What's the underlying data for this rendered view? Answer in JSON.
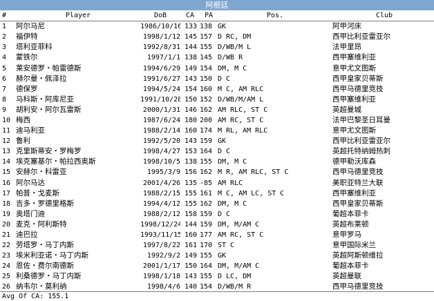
{
  "window": {
    "title": "阿根廷"
  },
  "columns": {
    "idx": "#",
    "player": "Player",
    "dob": "DoB",
    "ca": "CA",
    "pa": "PA",
    "pos": "Pos.",
    "club": "Club"
  },
  "rows": [
    {
      "idx": "1",
      "player": "阿尔马尼",
      "dob": "1986/10/16",
      "ca": "133",
      "pa": "138",
      "pos": "GK",
      "club": "阿甲河床"
    },
    {
      "idx": "2",
      "player": "福伊特",
      "dob": "1998/1/12",
      "ca": "145",
      "pa": "157",
      "pos": "D RC, DM",
      "club": "西甲比利亚雷亚尔"
    },
    {
      "idx": "3",
      "player": "塔利亚菲科",
      "dob": "1992/8/31",
      "ca": "144",
      "pa": "155",
      "pos": "D/WB/M L",
      "club": "法甲里昂"
    },
    {
      "idx": "4",
      "player": "蒙铁尔",
      "dob": "1997/1/1",
      "ca": "138",
      "pa": "145",
      "pos": "D/WB R",
      "club": "西甲塞维利亚"
    },
    {
      "idx": "5",
      "player": "莱安德罗・帕雷德斯",
      "dob": "1994/6/29",
      "ca": "149",
      "pa": "154",
      "pos": "DM, M C",
      "club": "意甲尤文图斯"
    },
    {
      "idx": "6",
      "player": "赫尔曼・佩泽拉",
      "dob": "1991/6/27",
      "ca": "143",
      "pa": "150",
      "pos": "D C",
      "club": "西甲皇家贝蒂斯"
    },
    {
      "idx": "7",
      "player": "德保罗",
      "dob": "1994/5/24",
      "ca": "154",
      "pa": "160",
      "pos": "M C, AM RLC",
      "club": "西甲马德里竞技"
    },
    {
      "idx": "8",
      "player": "马科斯・阿库尼亚",
      "dob": "1991/10/28",
      "ca": "150",
      "pa": "152",
      "pos": "D/WB/M/AM L",
      "club": "西甲塞维利亚"
    },
    {
      "idx": "9",
      "player": "胡利安・阿尔瓦雷斯",
      "dob": "2000/1/31",
      "ca": "146",
      "pa": "162",
      "pos": "AM RLC, ST C",
      "club": "英超曼城"
    },
    {
      "idx": "10",
      "player": "梅西",
      "dob": "1987/6/24",
      "ca": "180",
      "pa": "200",
      "pos": "AM RC, ST C",
      "club": "法甲巴黎圣日耳曼"
    },
    {
      "idx": "11",
      "player": "迪马利亚",
      "dob": "1988/2/14",
      "ca": "160",
      "pa": "174",
      "pos": "M RL, AM RLC",
      "club": "意甲尤文图斯"
    },
    {
      "idx": "12",
      "player": "鲁利",
      "dob": "1992/5/20",
      "ca": "143",
      "pa": "159",
      "pos": "GK",
      "club": "西甲比利亚雷亚尔"
    },
    {
      "idx": "13",
      "player": "克里斯蒂安・罗梅罗",
      "dob": "1998/4/27",
      "ca": "153",
      "pa": "164",
      "pos": "D C",
      "club": "英超托特纳姆热刺"
    },
    {
      "idx": "14",
      "player": "埃克塞基尔・帕拉西奥斯",
      "dob": "1998/10/5",
      "ca": "138",
      "pa": "155",
      "pos": "DM, M C",
      "club": "德甲勒沃库森"
    },
    {
      "idx": "15",
      "player": "安赫尔・科雷亚",
      "dob": "1995/3/9",
      "ca": "156",
      "pa": "162",
      "pos": "M R, AM RLC, ST C",
      "club": "西甲马德里竞技"
    },
    {
      "idx": "16",
      "player": "阿尔马达",
      "dob": "2001/4/26",
      "ca": "135",
      "pa": "-85",
      "pos": "AM RLC",
      "club": "美职亚特兰大联"
    },
    {
      "idx": "17",
      "player": "帕普・戈麦斯",
      "dob": "1988/2/15",
      "ca": "155",
      "pa": "161",
      "pos": "M C, AM LC, ST C",
      "club": "西甲塞维利亚"
    },
    {
      "idx": "18",
      "player": "吉多・罗德里格斯",
      "dob": "1994/4/12",
      "ca": "155",
      "pa": "162",
      "pos": "DM, M C",
      "club": "西甲皇家贝蒂斯"
    },
    {
      "idx": "19",
      "player": "奥塔门迪",
      "dob": "1988/2/12",
      "ca": "158",
      "pa": "159",
      "pos": "D C",
      "club": "葡超本菲卡"
    },
    {
      "idx": "20",
      "player": "麦克・阿利斯特",
      "dob": "1998/12/24",
      "ca": "144",
      "pa": "159",
      "pos": "DM, M/AM C",
      "club": "英超布莱顿"
    },
    {
      "idx": "21",
      "player": "迪巴拉",
      "dob": "1993/11/15",
      "ca": "160",
      "pa": "177",
      "pos": "AM RC, ST C",
      "club": "意甲罗马"
    },
    {
      "idx": "22",
      "player": "劳塔罗・马丁内斯",
      "dob": "1997/8/22",
      "ca": "161",
      "pa": "170",
      "pos": "ST C",
      "club": "意甲国际米兰"
    },
    {
      "idx": "23",
      "player": "埃米利亚诺・马丁内斯",
      "dob": "1992/9/2",
      "ca": "149",
      "pa": "155",
      "pos": "GK",
      "club": "英超阿斯顿维拉"
    },
    {
      "idx": "24",
      "player": "恩佐・费尔南德斯",
      "dob": "2001/1/17",
      "ca": "150",
      "pa": "164",
      "pos": "DM, M/AM C",
      "club": "葡超本菲卡"
    },
    {
      "idx": "25",
      "player": "利桑德罗・马丁内斯",
      "dob": "1998/1/18",
      "ca": "143",
      "pa": "155",
      "pos": "D LC, DM",
      "club": "英超曼联"
    },
    {
      "idx": "26",
      "player": "纳韦尔・莫利纳",
      "dob": "1998/4/6",
      "ca": "140",
      "pa": "154",
      "pos": "D/WB/M R",
      "club": "西甲马德里竞技"
    }
  ],
  "footer": {
    "avg_text": "Avg Of CA: 155.1"
  }
}
